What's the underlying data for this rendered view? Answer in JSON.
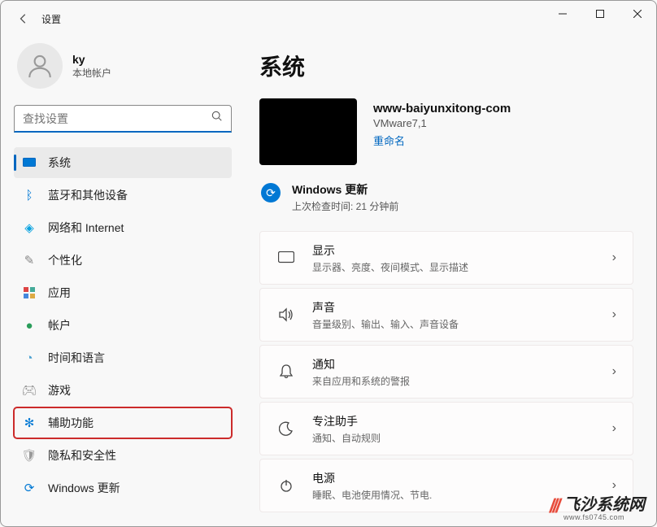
{
  "window": {
    "title": "设置"
  },
  "account": {
    "name": "ky",
    "type": "本地帐户"
  },
  "search": {
    "placeholder": "查找设置"
  },
  "nav": {
    "items": [
      {
        "label": "系统"
      },
      {
        "label": "蓝牙和其他设备"
      },
      {
        "label": "网络和 Internet"
      },
      {
        "label": "个性化"
      },
      {
        "label": "应用"
      },
      {
        "label": "帐户"
      },
      {
        "label": "时间和语言"
      },
      {
        "label": "游戏"
      },
      {
        "label": "辅助功能"
      },
      {
        "label": "隐私和安全性"
      },
      {
        "label": "Windows 更新"
      }
    ]
  },
  "main": {
    "title": "系统",
    "device": {
      "name": "www-baiyunxitong-com",
      "model": "VMware7,1",
      "rename": "重命名"
    },
    "update": {
      "title": "Windows 更新",
      "sub": "上次检查时间: 21 分钟前"
    },
    "cards": [
      {
        "title": "显示",
        "sub": "显示器、亮度、夜间模式、显示描述"
      },
      {
        "title": "声音",
        "sub": "音量级别、输出、输入、声音设备"
      },
      {
        "title": "通知",
        "sub": "来自应用和系统的警报"
      },
      {
        "title": "专注助手",
        "sub": "通知、自动规则"
      },
      {
        "title": "电源",
        "sub": "睡眠、电池使用情况、节电."
      }
    ]
  },
  "watermark": {
    "text": "飞沙系统网",
    "sub": "www.fs0745.com"
  }
}
